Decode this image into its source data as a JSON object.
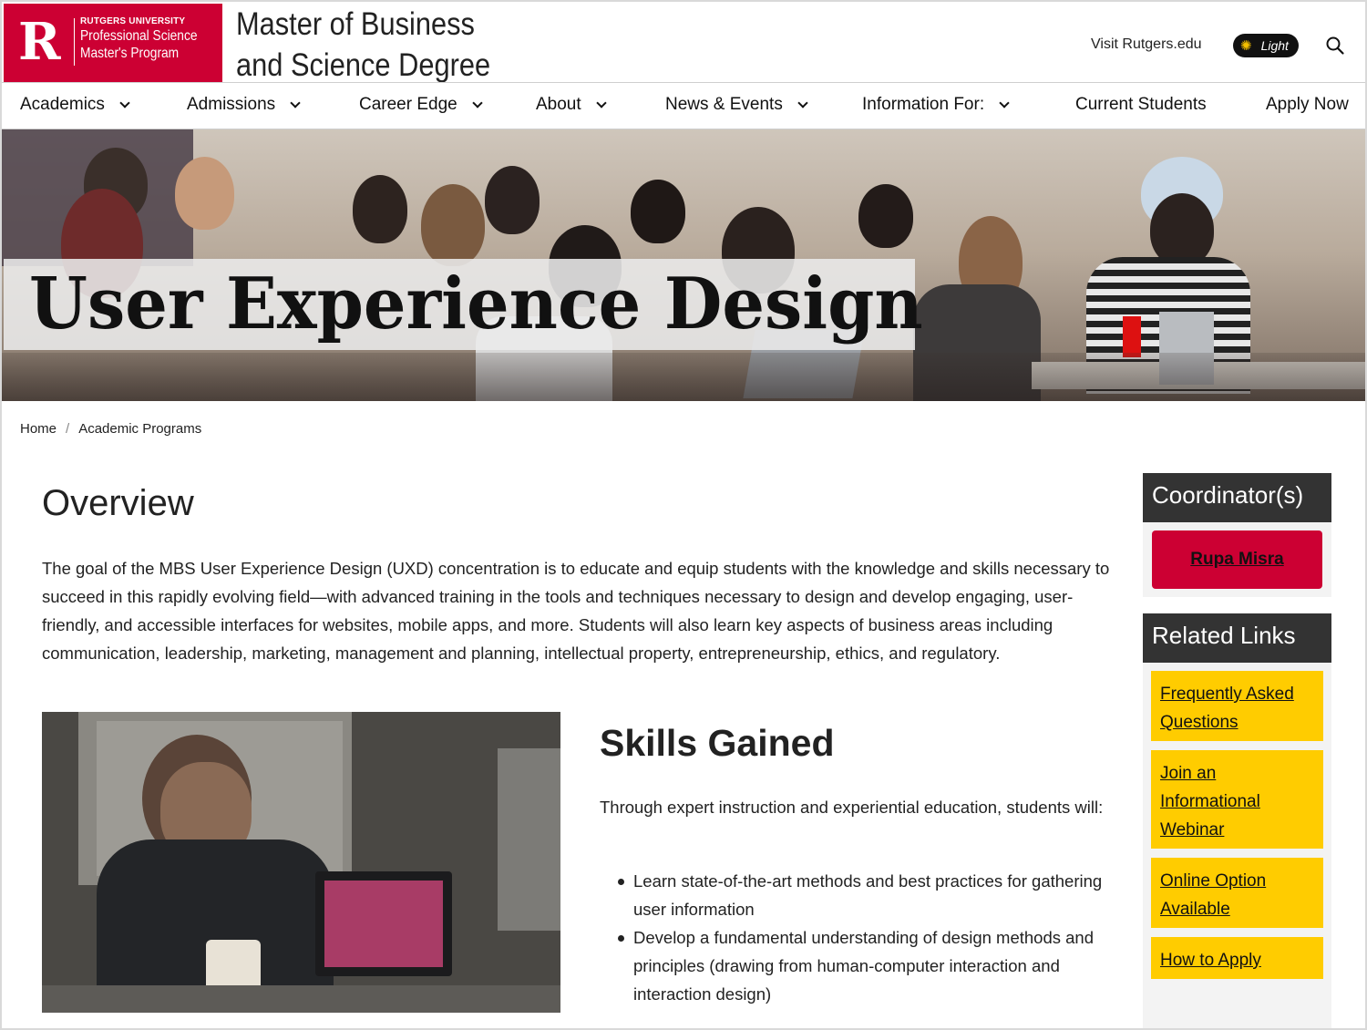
{
  "header": {
    "logo": {
      "letter": "R",
      "university": "RUTGERS UNIVERSITY",
      "program_line1": "Professional Science",
      "program_line2": "Master's Program"
    },
    "site_title_line1": "Master of Business",
    "site_title_line2": "and Science Degree",
    "visit_link": "Visit Rutgers.edu",
    "theme_toggle": "Light"
  },
  "nav": {
    "items": [
      {
        "label": "Academics",
        "dropdown": true
      },
      {
        "label": "Admissions",
        "dropdown": true
      },
      {
        "label": "Career Edge",
        "dropdown": true
      },
      {
        "label": "About",
        "dropdown": true
      },
      {
        "label": "News & Events",
        "dropdown": true
      },
      {
        "label": "Information For:",
        "dropdown": true
      },
      {
        "label": "Current Students",
        "dropdown": false
      },
      {
        "label": "Apply Now",
        "dropdown": false
      }
    ]
  },
  "hero": {
    "title": "User Experience Design"
  },
  "breadcrumb": {
    "items": [
      "Home",
      "Academic Programs"
    ],
    "separator": "/"
  },
  "main": {
    "overview_heading": "Overview",
    "overview_text": "The goal of the MBS User Experience Design (UXD) concentration is to educate and equip students with the knowledge and skills necessary to succeed in this rapidly evolving field—with advanced training in the tools and techniques necessary to design and develop engaging, user-friendly, and accessible interfaces for websites, mobile apps, and more. Students will also learn key aspects of business areas including communication, leadership, marketing, management and planning, intellectual property, entrepreneurship, ethics, and regulatory.",
    "skills_heading": "Skills Gained",
    "skills_intro": "Through expert instruction and experiential education, students will:",
    "skills": [
      "Learn state-of-the-art methods and best practices for gathering user information",
      "Develop a fundamental understanding of design methods and principles (drawing from human-computer interaction and interaction design)"
    ]
  },
  "sidebar": {
    "coordinator_heading": "Coordinator(s)",
    "coordinator_name": "Rupa Misra",
    "related_heading": "Related Links",
    "related_links": [
      "Frequently Asked Questions",
      "Join an Informational Webinar",
      "Online Option Available",
      "How to Apply"
    ]
  },
  "colors": {
    "brand_red": "#cc0033",
    "link_yellow": "#ffcc00",
    "sidebar_header": "#333333",
    "toggle_bg": "#111111"
  },
  "icons": [
    "sun-icon",
    "search-icon",
    "chevron-down-icon"
  ]
}
